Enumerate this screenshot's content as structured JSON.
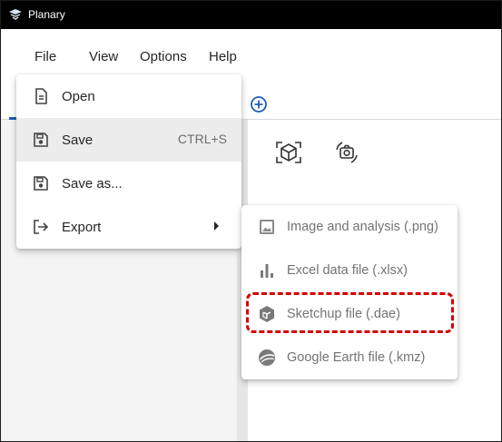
{
  "window": {
    "title": "Planary",
    "app_icon": "planary-logo-icon"
  },
  "menubar": {
    "items": [
      {
        "label": "File"
      },
      {
        "label": "View"
      },
      {
        "label": "Options"
      },
      {
        "label": "Help"
      }
    ]
  },
  "file_menu": {
    "items": [
      {
        "label": "Open",
        "icon": "document-icon"
      },
      {
        "label": "Save",
        "shortcut": "CTRL+S",
        "icon": "floppy-disk-icon",
        "selected": true
      },
      {
        "label": "Save as...",
        "icon": "floppy-disk-icon"
      },
      {
        "label": "Export",
        "icon": "export-arrow-icon",
        "has_submenu": true
      }
    ]
  },
  "export_menu": {
    "items": [
      {
        "label": "Image and analysis (.png)",
        "icon": "image-icon"
      },
      {
        "label": "Excel data file (.xlsx)",
        "icon": "bar-chart-icon"
      },
      {
        "label": "Sketchup file (.dae)",
        "icon": "sketchup-icon",
        "highlighted": true
      },
      {
        "label": "Google Earth file (.kmz)",
        "icon": "google-earth-icon"
      }
    ]
  },
  "colors": {
    "titlebar": "#000000",
    "menu_text": "#262626",
    "submenu_text": "#737373",
    "selected_item": "#ececec",
    "highlight": "#d40000",
    "accent": "#1f5fb8"
  }
}
